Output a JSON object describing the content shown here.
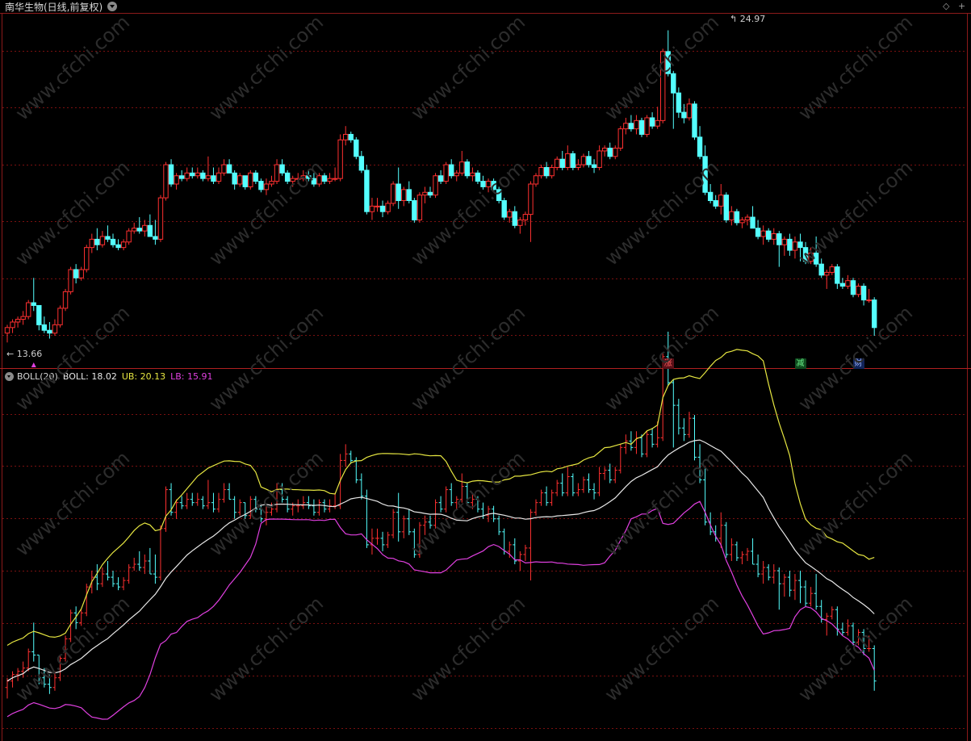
{
  "header": {
    "stock_title": "南华生物(日线,前复权)",
    "corner_icons": [
      "diamond-icon",
      "plus-icon"
    ]
  },
  "price_panel": {
    "high_label": "24.97",
    "low_label": "13.66",
    "badges": [
      {
        "text": "涨",
        "bg": "#5a1018",
        "color": "#ff6060",
        "candle_index": 125
      },
      {
        "text": "减",
        "bg": "#0f4a1e",
        "color": "#6cf08a",
        "candle_index": 150
      },
      {
        "text": "财",
        "bg": "#11245a",
        "color": "#9fb6ff",
        "candle_index": 161
      }
    ]
  },
  "indicator_panel": {
    "name": "BOLL(20)",
    "boll_text": "BOLL: 18.02",
    "ub_text": "UB: 20.13",
    "lb_text": "LB: 15.91"
  },
  "colors": {
    "up": "#ff3030",
    "down": "#54ffff",
    "boll": "#e8e8e8",
    "ub": "#e6e641",
    "lb": "#e040e0",
    "grid": "#7a1010",
    "watermark": "#2c2c2c"
  },
  "watermark_text": "www.cfchi.com",
  "chart_data": {
    "type": "candlestick",
    "x": "trading days (167 bars)",
    "y_range": [
      13.2,
      25.6
    ],
    "ohlc": [
      [
        14.0,
        14.3,
        13.66,
        14.2
      ],
      [
        14.2,
        14.5,
        14.0,
        14.4
      ],
      [
        14.4,
        14.6,
        14.2,
        14.5
      ],
      [
        14.5,
        14.8,
        14.3,
        14.6
      ],
      [
        14.6,
        15.2,
        14.5,
        15.1
      ],
      [
        15.1,
        16.0,
        14.8,
        15.0
      ],
      [
        15.0,
        15.0,
        14.1,
        14.3
      ],
      [
        14.3,
        14.6,
        14.0,
        14.1
      ],
      [
        14.1,
        14.4,
        13.8,
        14.0
      ],
      [
        14.0,
        14.5,
        13.9,
        14.3
      ],
      [
        14.3,
        15.0,
        14.2,
        14.9
      ],
      [
        14.9,
        15.6,
        14.8,
        15.5
      ],
      [
        15.5,
        16.4,
        15.4,
        16.3
      ],
      [
        16.3,
        16.5,
        15.8,
        16.0
      ],
      [
        16.0,
        16.4,
        15.9,
        16.3
      ],
      [
        16.3,
        17.2,
        16.2,
        17.1
      ],
      [
        17.1,
        17.6,
        16.9,
        17.4
      ],
      [
        17.4,
        17.8,
        17.0,
        17.2
      ],
      [
        17.2,
        17.7,
        17.1,
        17.5
      ],
      [
        17.5,
        17.9,
        17.3,
        17.4
      ],
      [
        17.4,
        17.6,
        17.1,
        17.2
      ],
      [
        17.2,
        17.4,
        17.0,
        17.1
      ],
      [
        17.1,
        17.4,
        17.0,
        17.3
      ],
      [
        17.3,
        17.8,
        17.2,
        17.7
      ],
      [
        17.7,
        18.0,
        17.6,
        17.8
      ],
      [
        17.8,
        18.2,
        17.6,
        17.7
      ],
      [
        17.7,
        18.1,
        17.5,
        17.9
      ],
      [
        17.9,
        18.3,
        17.5,
        17.5
      ],
      [
        17.5,
        18.1,
        17.2,
        17.4
      ],
      [
        17.4,
        19.0,
        17.3,
        18.9
      ],
      [
        18.9,
        20.2,
        18.8,
        20.1
      ],
      [
        20.1,
        20.3,
        19.3,
        19.4
      ],
      [
        19.4,
        19.8,
        19.2,
        19.7
      ],
      [
        19.7,
        19.9,
        19.5,
        19.6
      ],
      [
        19.6,
        20.0,
        19.5,
        19.8
      ],
      [
        19.8,
        20.0,
        19.6,
        19.7
      ],
      [
        19.7,
        20.0,
        19.6,
        19.8
      ],
      [
        19.8,
        19.9,
        19.5,
        19.6
      ],
      [
        19.6,
        20.4,
        19.5,
        19.7
      ],
      [
        19.7,
        20.0,
        19.4,
        19.5
      ],
      [
        19.5,
        20.0,
        19.4,
        19.8
      ],
      [
        19.8,
        20.3,
        19.7,
        20.1
      ],
      [
        20.1,
        20.3,
        19.8,
        19.8
      ],
      [
        19.8,
        19.9,
        19.2,
        19.4
      ],
      [
        19.4,
        19.8,
        19.3,
        19.7
      ],
      [
        19.7,
        19.7,
        19.2,
        19.3
      ],
      [
        19.3,
        19.9,
        19.2,
        19.8
      ],
      [
        19.8,
        19.9,
        19.4,
        19.5
      ],
      [
        19.5,
        19.6,
        19.1,
        19.2
      ],
      [
        19.2,
        19.6,
        19.0,
        19.4
      ],
      [
        19.4,
        19.7,
        19.3,
        19.5
      ],
      [
        19.5,
        20.3,
        19.4,
        20.1
      ],
      [
        20.1,
        20.3,
        19.7,
        19.8
      ],
      [
        19.8,
        19.9,
        19.4,
        19.5
      ],
      [
        19.5,
        19.7,
        19.3,
        19.6
      ],
      [
        19.6,
        19.8,
        19.4,
        19.6
      ],
      [
        19.6,
        19.9,
        19.5,
        19.7
      ],
      [
        19.7,
        19.9,
        19.5,
        19.6
      ],
      [
        19.6,
        19.8,
        19.3,
        19.4
      ],
      [
        19.4,
        19.8,
        19.3,
        19.7
      ],
      [
        19.7,
        19.8,
        19.4,
        19.5
      ],
      [
        19.5,
        19.8,
        19.4,
        19.6
      ],
      [
        19.6,
        20.0,
        19.5,
        19.6
      ],
      [
        19.6,
        21.2,
        19.5,
        21.0
      ],
      [
        21.0,
        21.5,
        20.8,
        21.2
      ],
      [
        21.2,
        21.3,
        20.9,
        21.0
      ],
      [
        21.0,
        21.1,
        20.3,
        20.4
      ],
      [
        20.4,
        20.6,
        19.8,
        19.9
      ],
      [
        19.9,
        20.1,
        18.3,
        18.4
      ],
      [
        18.4,
        18.9,
        18.1,
        18.6
      ],
      [
        18.6,
        18.9,
        18.4,
        18.6
      ],
      [
        18.6,
        18.8,
        18.2,
        18.4
      ],
      [
        18.4,
        18.8,
        18.3,
        18.7
      ],
      [
        18.7,
        19.5,
        18.6,
        19.4
      ],
      [
        19.4,
        20.0,
        18.5,
        18.8
      ],
      [
        18.8,
        19.3,
        18.6,
        19.2
      ],
      [
        19.2,
        19.5,
        18.7,
        18.8
      ],
      [
        18.8,
        18.9,
        18.0,
        18.1
      ],
      [
        18.1,
        19.1,
        18.0,
        19.0
      ],
      [
        19.0,
        19.3,
        18.7,
        19.1
      ],
      [
        19.1,
        19.3,
        18.9,
        19.0
      ],
      [
        19.0,
        19.8,
        18.9,
        19.7
      ],
      [
        19.7,
        19.9,
        19.4,
        19.5
      ],
      [
        19.5,
        20.2,
        19.4,
        20.1
      ],
      [
        20.1,
        20.3,
        19.6,
        19.7
      ],
      [
        19.7,
        19.9,
        19.5,
        19.8
      ],
      [
        19.8,
        20.6,
        19.7,
        20.2
      ],
      [
        20.2,
        20.3,
        19.6,
        19.7
      ],
      [
        19.7,
        20.0,
        19.5,
        19.8
      ],
      [
        19.8,
        19.9,
        19.4,
        19.5
      ],
      [
        19.5,
        19.7,
        19.2,
        19.3
      ],
      [
        19.3,
        19.6,
        19.1,
        19.5
      ],
      [
        19.5,
        19.6,
        19.1,
        19.2
      ],
      [
        19.2,
        19.3,
        18.7,
        18.8
      ],
      [
        18.8,
        18.9,
        18.1,
        18.2
      ],
      [
        18.2,
        18.5,
        18.0,
        18.4
      ],
      [
        18.4,
        18.6,
        17.8,
        17.9
      ],
      [
        17.9,
        18.2,
        17.6,
        18.1
      ],
      [
        18.1,
        18.4,
        17.9,
        18.3
      ],
      [
        18.3,
        19.5,
        17.3,
        19.4
      ],
      [
        19.4,
        19.8,
        19.3,
        19.7
      ],
      [
        19.7,
        20.1,
        19.6,
        20.0
      ],
      [
        20.0,
        20.2,
        19.6,
        19.7
      ],
      [
        19.7,
        20.1,
        19.6,
        20.0
      ],
      [
        20.0,
        20.4,
        19.9,
        20.3
      ],
      [
        20.3,
        20.6,
        19.9,
        20.0
      ],
      [
        20.0,
        20.8,
        19.9,
        20.5
      ],
      [
        20.5,
        20.6,
        19.9,
        20.0
      ],
      [
        20.0,
        20.3,
        19.9,
        20.1
      ],
      [
        20.1,
        20.5,
        20.0,
        20.4
      ],
      [
        20.4,
        20.6,
        20.0,
        20.1
      ],
      [
        20.1,
        20.3,
        19.8,
        20.0
      ],
      [
        20.0,
        20.8,
        19.9,
        20.6
      ],
      [
        20.6,
        20.8,
        20.4,
        20.7
      ],
      [
        20.7,
        20.9,
        20.3,
        20.4
      ],
      [
        20.4,
        20.8,
        20.3,
        20.7
      ],
      [
        20.7,
        21.5,
        20.6,
        21.4
      ],
      [
        21.4,
        21.8,
        21.2,
        21.6
      ],
      [
        21.6,
        21.9,
        21.3,
        21.4
      ],
      [
        21.4,
        21.9,
        21.2,
        21.7
      ],
      [
        21.7,
        21.8,
        21.1,
        21.2
      ],
      [
        21.2,
        21.9,
        21.1,
        21.8
      ],
      [
        21.8,
        22.0,
        21.4,
        21.5
      ],
      [
        21.5,
        22.2,
        21.4,
        21.7
      ],
      [
        21.7,
        24.3,
        21.6,
        24.2
      ],
      [
        24.2,
        24.97,
        23.3,
        23.4
      ],
      [
        23.4,
        23.5,
        21.4,
        22.7
      ],
      [
        22.7,
        22.9,
        21.8,
        22.0
      ],
      [
        22.0,
        22.3,
        21.6,
        21.8
      ],
      [
        21.8,
        22.5,
        21.7,
        22.3
      ],
      [
        22.3,
        22.4,
        21.0,
        21.1
      ],
      [
        21.1,
        21.5,
        20.3,
        20.4
      ],
      [
        20.4,
        20.8,
        19.0,
        19.1
      ],
      [
        19.1,
        19.4,
        18.7,
        18.8
      ],
      [
        18.8,
        19.0,
        18.5,
        18.6
      ],
      [
        18.6,
        19.4,
        18.3,
        19.0
      ],
      [
        19.0,
        19.1,
        18.0,
        18.1
      ],
      [
        18.1,
        18.6,
        17.9,
        18.4
      ],
      [
        18.4,
        18.5,
        17.9,
        18.0
      ],
      [
        18.0,
        18.2,
        17.8,
        18.1
      ],
      [
        18.1,
        18.3,
        17.9,
        18.2
      ],
      [
        18.2,
        18.6,
        17.8,
        17.8
      ],
      [
        17.8,
        18.1,
        17.4,
        17.5
      ],
      [
        17.5,
        17.9,
        17.2,
        17.7
      ],
      [
        17.7,
        17.8,
        17.3,
        17.4
      ],
      [
        17.4,
        17.8,
        17.2,
        17.6
      ],
      [
        17.6,
        17.7,
        16.4,
        17.2
      ],
      [
        17.2,
        17.5,
        16.8,
        17.4
      ],
      [
        17.4,
        17.6,
        16.8,
        17.0
      ],
      [
        17.0,
        17.5,
        16.7,
        17.3
      ],
      [
        17.3,
        17.6,
        16.6,
        17.1
      ],
      [
        17.1,
        17.3,
        16.5,
        16.6
      ],
      [
        16.6,
        17.1,
        16.5,
        16.9
      ],
      [
        16.9,
        17.5,
        16.4,
        16.5
      ],
      [
        16.5,
        16.7,
        16.0,
        16.1
      ],
      [
        16.1,
        16.3,
        15.6,
        16.2
      ],
      [
        16.2,
        16.5,
        16.1,
        16.4
      ],
      [
        16.4,
        16.5,
        15.6,
        15.8
      ],
      [
        15.8,
        16.0,
        15.6,
        15.7
      ],
      [
        15.7,
        16.1,
        15.6,
        15.9
      ],
      [
        15.9,
        16.0,
        15.3,
        15.4
      ],
      [
        15.4,
        15.8,
        15.3,
        15.7
      ],
      [
        15.7,
        15.8,
        15.0,
        15.2
      ],
      [
        15.2,
        15.6,
        15.1,
        15.2
      ],
      [
        15.2,
        15.3,
        13.9,
        14.2
      ]
    ]
  }
}
